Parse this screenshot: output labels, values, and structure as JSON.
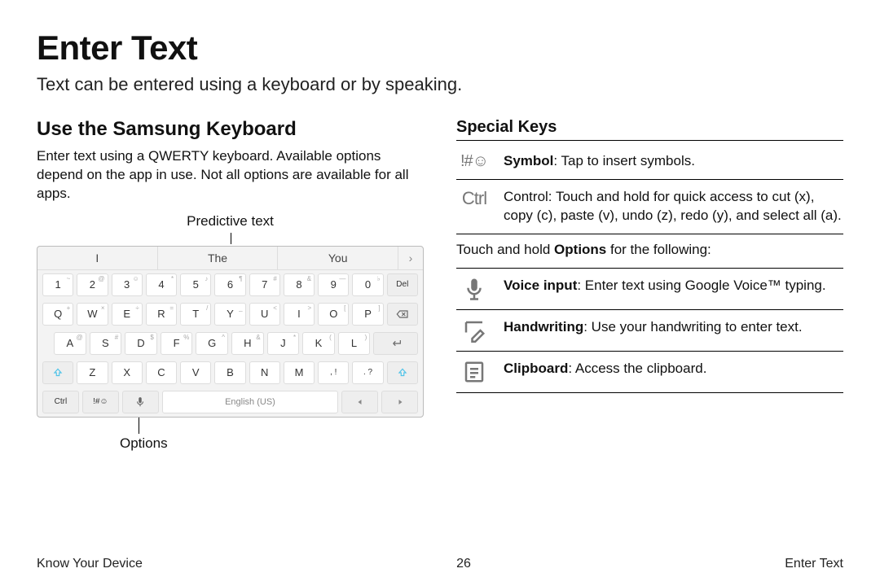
{
  "page": {
    "title": "Enter Text",
    "subtitle": "Text can be entered using a keyboard or by speaking."
  },
  "left": {
    "heading": "Use the Samsung Keyboard",
    "body": "Enter text using a QWERTY keyboard. Available options depend on the app in use. Not all options are available for all apps.",
    "callout_top": "Predictive text",
    "callout_bottom": "Options",
    "predictive": {
      "a": "I",
      "b": "The",
      "c": "You",
      "more": "›"
    },
    "row1": {
      "k1": "1",
      "k2": "2",
      "k3": "3",
      "k4": "4",
      "k5": "5",
      "k6": "6",
      "k7": "7",
      "k8": "8",
      "k9": "9",
      "k0": "0",
      "del": "Del"
    },
    "row2": {
      "q": "Q",
      "w": "W",
      "e": "E",
      "r": "R",
      "t": "T",
      "y": "Y",
      "u": "U",
      "i": "I",
      "o": "O",
      "p": "P"
    },
    "row3": {
      "a": "A",
      "s": "S",
      "d": "D",
      "f": "F",
      "g": "G",
      "h": "H",
      "j": "J",
      "k": "K",
      "l": "L"
    },
    "row4": {
      "z": "Z",
      "x": "X",
      "c": "C",
      "v": "V",
      "b": "B",
      "n": "N",
      "m": "M",
      "comma": ", !",
      "period": ". ?"
    },
    "row5": {
      "ctrl": "Ctrl",
      "sym": "!#☺",
      "space": "English (US)"
    }
  },
  "right": {
    "heading": "Special Keys",
    "items": {
      "symbol": {
        "icon": "!#☺",
        "bold": "Symbol",
        "rest": ": Tap to insert symbols."
      },
      "control": {
        "icon": "Ctrl",
        "text": "Control: Touch and hold for quick access to cut (x), copy (c), paste (v), undo (z), redo (y), and select all (a)."
      },
      "intro": {
        "a": "Touch and hold ",
        "b": "Options",
        "c": " for the following:"
      },
      "voice": {
        "bold": "Voice input",
        "rest": ": Enter text using Google Voice™ typing."
      },
      "hand": {
        "bold": "Handwriting",
        "rest": ": Use your handwriting to enter text."
      },
      "clip": {
        "bold": "Clipboard",
        "rest": ": Access the clipboard."
      }
    }
  },
  "footer": {
    "left": "Know Your Device",
    "center": "26",
    "right": "Enter Text"
  }
}
